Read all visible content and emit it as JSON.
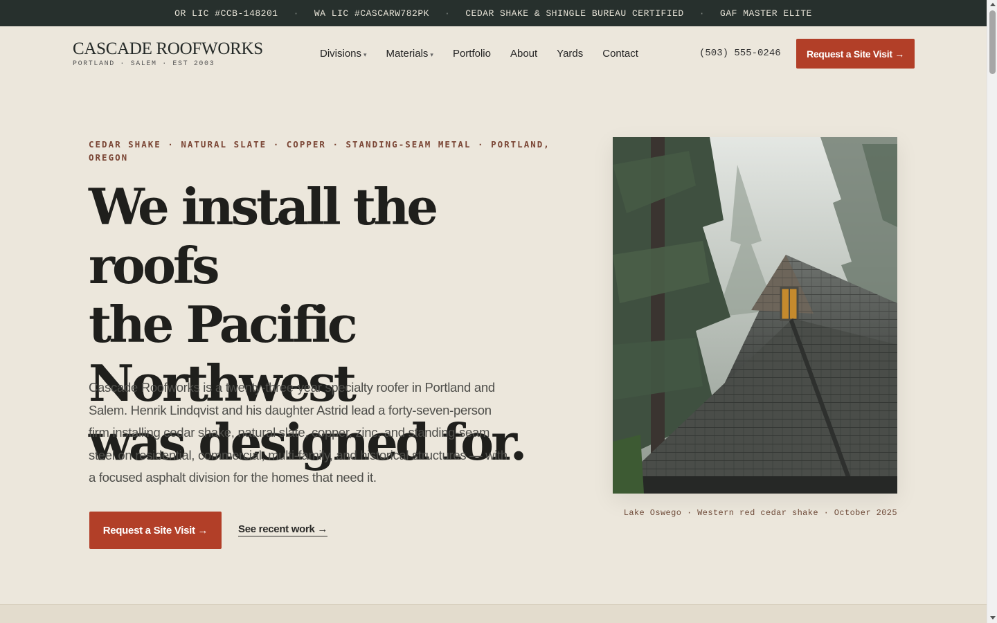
{
  "topbar": {
    "items": [
      "OR LIC #CCB-148201",
      "WA LIC #CASCARW782PK",
      "CEDAR SHAKE & SHINGLE BUREAU CERTIFIED",
      "GAF MASTER ELITE"
    ],
    "separator": "·"
  },
  "brand": {
    "name": "CASCADE ROOFWORKS",
    "tagline": "PORTLAND · SALEM · EST 2003"
  },
  "nav": {
    "items": [
      {
        "label": "Divisions",
        "caret": "▾"
      },
      {
        "label": "Materials",
        "caret": "▾"
      },
      {
        "label": "Portfolio"
      },
      {
        "label": "About"
      },
      {
        "label": "Yards"
      },
      {
        "label": "Contact"
      }
    ]
  },
  "header": {
    "phone": "(503) 555-0246",
    "cta": "Request a Site Visit →"
  },
  "hero": {
    "eyebrow": "CEDAR SHAKE · NATURAL SLATE · COPPER · STANDING-SEAM METAL · PORTLAND, OREGON",
    "headline_lines": [
      "We install the roofs",
      "the Pacific Northwest",
      "was designed for."
    ],
    "body": "Cascade Roofworks is a twenty-three-year specialty roofer in Portland and Salem. Henrik Lindqvist and his daughter Astrid lead a forty-seven-person firm installing cedar shake, natural slate, copper, zinc, and standing-seam steel on residential, commercial, multi-family, and historical structures — with a focused asphalt division for the homes that need it.",
    "primary_cta": "Request a Site Visit →",
    "secondary_cta": "See recent work →"
  },
  "photo": {
    "caption": "Lake Oswego · Western red cedar shake · October 2025"
  },
  "colors": {
    "accent": "#b23f28",
    "topbar": "#27302d",
    "background": "#ece7dc",
    "eyebrow": "#7a4534"
  }
}
